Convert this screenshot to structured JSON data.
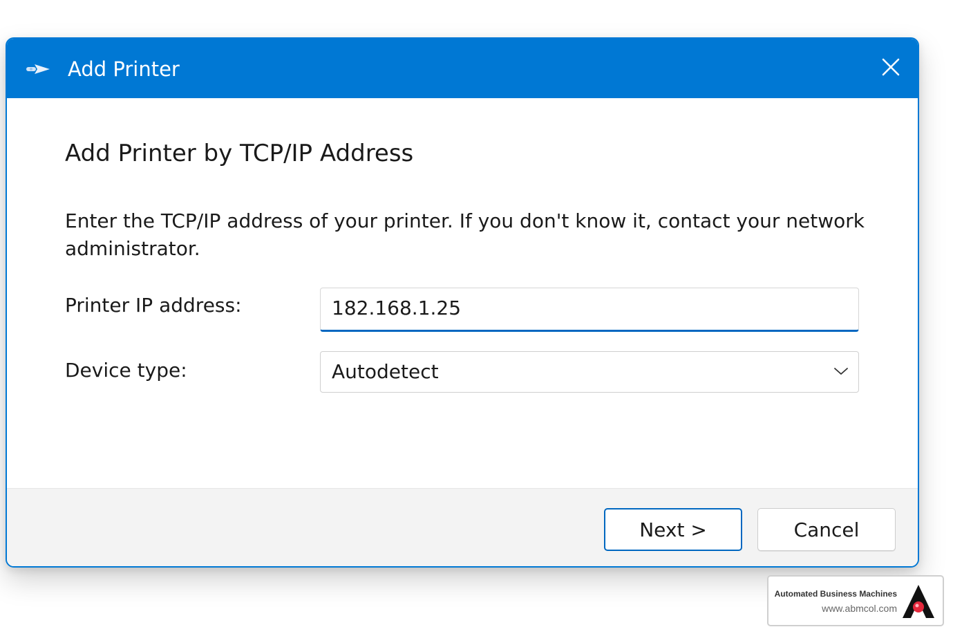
{
  "window": {
    "title": "Add Printer",
    "icon": "printer-arrow-icon",
    "close_icon": "close-icon",
    "accent_color": "#0078d4"
  },
  "main": {
    "heading": "Add Printer by TCP/IP Address",
    "description": "Enter the TCP/IP address of your printer. If you don't know it, contact your network administrator.",
    "ip_label": "Printer IP address:",
    "ip_value": "182.168.1.25",
    "device_type_label": "Device type:",
    "device_type_value": "Autodetect",
    "dropdown_icon": "chevron-down-icon"
  },
  "footer": {
    "next_label": "Next >",
    "cancel_label": "Cancel"
  },
  "badge": {
    "company": "Automated Business Machines",
    "url": "www.abmcol.com",
    "logo": "abm-logo"
  }
}
